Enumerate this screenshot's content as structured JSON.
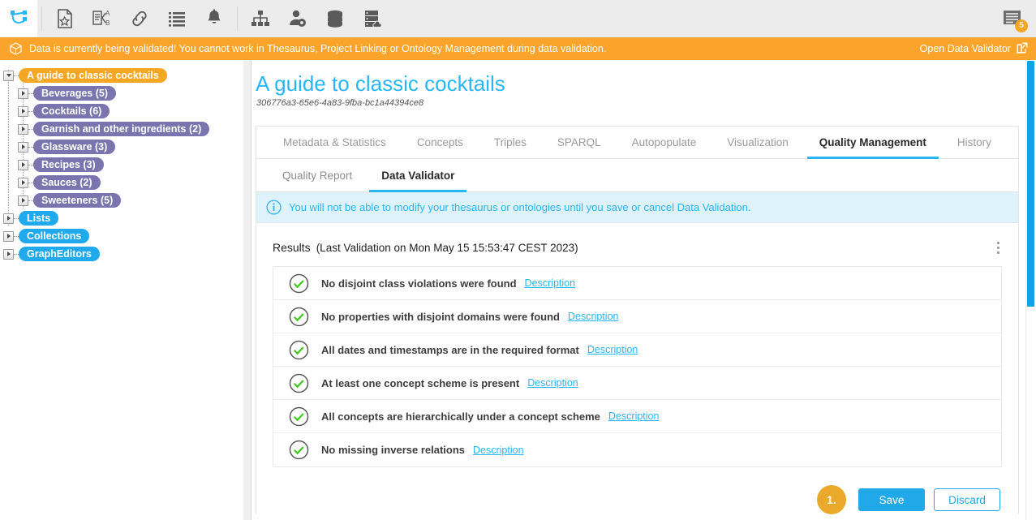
{
  "toolbar": {
    "home_icon": "graph-logo-icon",
    "items": [
      {
        "name": "document-star-icon",
        "label": "Project"
      },
      {
        "name": "document-alphabet-icon",
        "label": "Thesaurus"
      },
      {
        "name": "link-icon",
        "label": "Project Linking"
      },
      {
        "name": "list-icon",
        "label": "Lists"
      },
      {
        "name": "bell-icon",
        "label": "Notifications"
      },
      {
        "name": "sitemap-icon",
        "label": "Ontology Management"
      },
      {
        "name": "user-settings-icon",
        "label": "User Management"
      },
      {
        "name": "database-icon",
        "label": "Database"
      },
      {
        "name": "server-cloud-icon",
        "label": "Server"
      }
    ],
    "notification": {
      "icon": "notes-icon",
      "badge": "5"
    }
  },
  "banner": {
    "icon": "cube-icon",
    "message": "Data is currently being validated! You cannot work in Thesaurus, Project Linking or Ontology Management during data validation.",
    "link_label": "Open Data Validator",
    "link_icon": "external-link-icon",
    "color": "#fba42c"
  },
  "tree": {
    "root": {
      "label": "A guide to classic cocktails",
      "color": "orange",
      "expanded": true
    },
    "children": [
      {
        "label": "Beverages (5)",
        "color": "purple"
      },
      {
        "label": "Cocktails (6)",
        "color": "purple"
      },
      {
        "label": "Garnish and other ingredients (2)",
        "color": "purple"
      },
      {
        "label": "Glassware (3)",
        "color": "purple"
      },
      {
        "label": "Recipes (3)",
        "color": "purple"
      },
      {
        "label": "Sauces (2)",
        "color": "purple"
      },
      {
        "label": "Sweeteners (5)",
        "color": "purple"
      }
    ],
    "roots_extra": [
      {
        "label": "Lists",
        "color": "blue"
      },
      {
        "label": "Collections",
        "color": "blue"
      },
      {
        "label": "GraphEditors",
        "color": "blue"
      }
    ]
  },
  "page": {
    "title": "A guide to classic cocktails",
    "uuid": "306776a3-65e6-4a83-9fba-bc1a44394ce8",
    "title_color": "#29b6f6"
  },
  "tabs": [
    {
      "label": "Metadata & Statistics",
      "active": false
    },
    {
      "label": "Concepts",
      "active": false
    },
    {
      "label": "Triples",
      "active": false
    },
    {
      "label": "SPARQL",
      "active": false
    },
    {
      "label": "Autopopulate",
      "active": false
    },
    {
      "label": "Visualization",
      "active": false
    },
    {
      "label": "Quality Management",
      "active": true
    },
    {
      "label": "History",
      "active": false
    }
  ],
  "subtabs": [
    {
      "label": "Quality Report",
      "active": false
    },
    {
      "label": "Data Validator",
      "active": true
    }
  ],
  "info": {
    "icon": "info-circle-icon",
    "text": "You will not be able to modify your thesaurus or ontologies until you save or cancel Data Validation."
  },
  "results": {
    "label": "Results",
    "meta": "(Last Validation on Mon May 15 15:53:47 CEST 2023)",
    "menu_icon": "kebab-menu-icon",
    "link_label": "Description",
    "rows": [
      {
        "status": "check-icon",
        "text": "No disjoint class violations were found"
      },
      {
        "status": "check-icon",
        "text": "No properties with disjoint domains were found"
      },
      {
        "status": "check-icon",
        "text": "All dates and timestamps are in the required format"
      },
      {
        "status": "check-icon",
        "text": "At least one concept scheme is present"
      },
      {
        "status": "check-icon",
        "text": "All concepts are hierarchically under a concept scheme"
      },
      {
        "status": "check-icon",
        "text": "No missing inverse relations"
      }
    ]
  },
  "actions": {
    "step_badge": "1.",
    "save_label": "Save",
    "discard_label": "Discard",
    "primary_color": "#20a8e8"
  }
}
